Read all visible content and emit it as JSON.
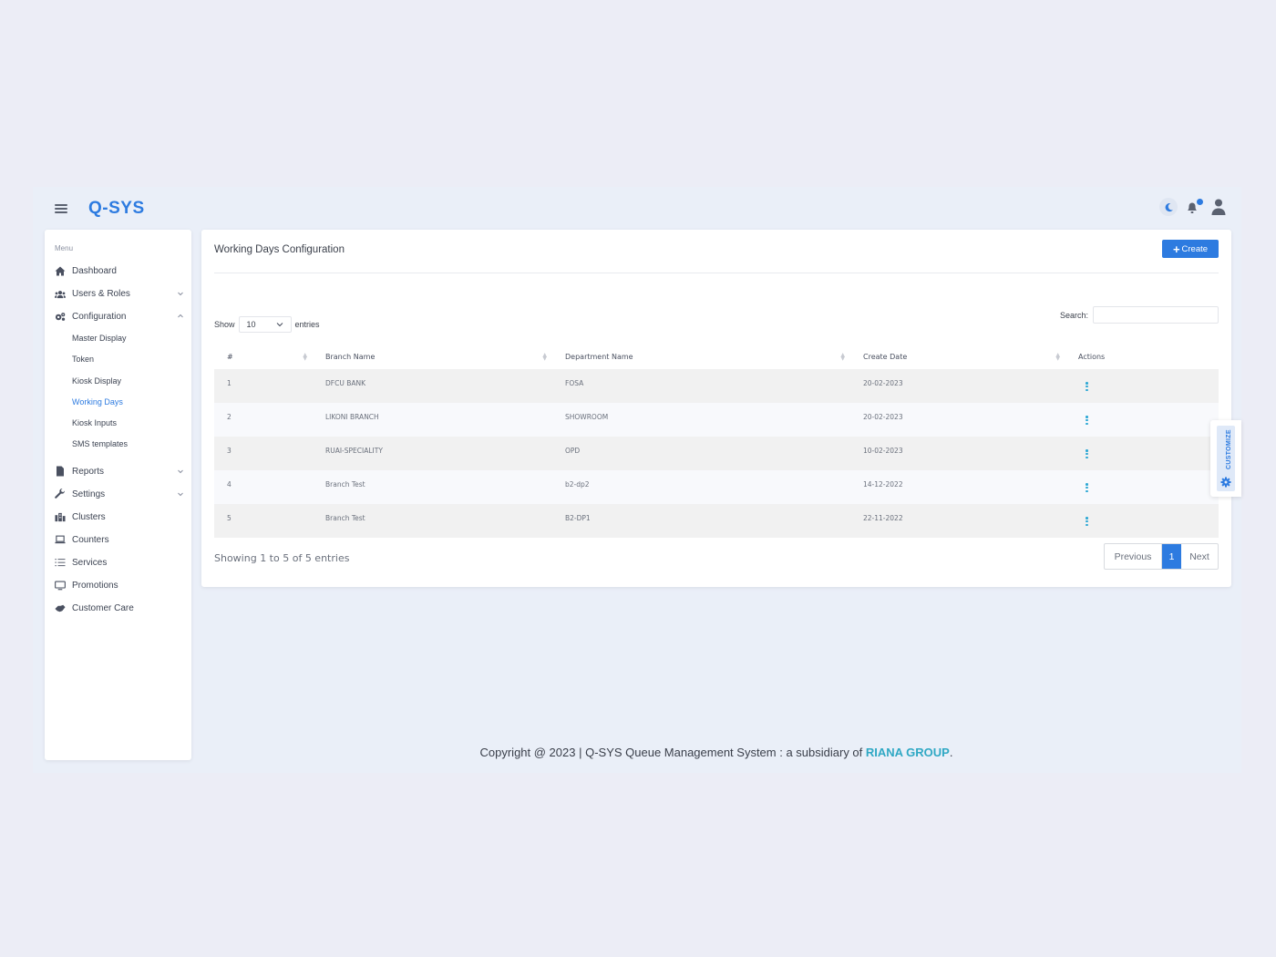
{
  "app": {
    "brand": "Q-SYS",
    "accent_color": "#2d7be0"
  },
  "topbar": {
    "icons": [
      "menu-icon",
      "moon-icon",
      "bell-icon",
      "user-icon"
    ]
  },
  "sidebar": {
    "menu_label": "Menu",
    "items": [
      {
        "label": "Dashboard",
        "icon": "home-icon"
      },
      {
        "label": "Users & Roles",
        "icon": "users-icon",
        "chevron": "down"
      },
      {
        "label": "Configuration",
        "icon": "cogs-icon",
        "chevron": "up",
        "children": [
          {
            "label": "Master Display"
          },
          {
            "label": "Token"
          },
          {
            "label": "Kiosk Display"
          },
          {
            "label": "Working Days",
            "active": true
          },
          {
            "label": "Kiosk Inputs"
          },
          {
            "label": "SMS templates"
          }
        ]
      },
      {
        "label": "Reports",
        "icon": "file-icon",
        "chevron": "down"
      },
      {
        "label": "Settings",
        "icon": "wrench-icon",
        "chevron": "down"
      },
      {
        "label": "Clusters",
        "icon": "building-icon"
      },
      {
        "label": "Counters",
        "icon": "laptop-icon"
      },
      {
        "label": "Services",
        "icon": "list-icon"
      },
      {
        "label": "Promotions",
        "icon": "desktop-icon"
      },
      {
        "label": "Customer Care",
        "icon": "handshake-icon"
      }
    ]
  },
  "main": {
    "title": "Working Days Configuration",
    "create_label": "Create",
    "show_label": "Show",
    "entries_label": "entries",
    "page_length": "10",
    "search_label": "Search:",
    "search_value": "",
    "columns": [
      "#",
      "Branch Name",
      "Department Name",
      "Create Date",
      "Actions"
    ],
    "rows": [
      {
        "num": "1",
        "branch": "DFCU BANK",
        "department": "FOSA",
        "date": "20-02-2023"
      },
      {
        "num": "2",
        "branch": "LIKONI BRANCH",
        "department": "SHOWROOM",
        "date": "20-02-2023"
      },
      {
        "num": "3",
        "branch": "RUAI-SPECIALITY",
        "department": "OPD",
        "date": "10-02-2023"
      },
      {
        "num": "4",
        "branch": "Branch Test",
        "department": "b2-dp2",
        "date": "14-12-2022"
      },
      {
        "num": "5",
        "branch": "Branch Test",
        "department": "B2-DP1",
        "date": "22-11-2022"
      }
    ],
    "info": "Showing 1 to 5 of 5 entries",
    "pagination": {
      "previous": "Previous",
      "current": "1",
      "next": "Next"
    }
  },
  "customize": {
    "label": "CUSTOMIZE"
  },
  "footer": {
    "text": "Copyright @ 2023 | Q-SYS Queue Management System : a subsidiary of ",
    "link": "RIANA GROUP",
    "suffix": "."
  }
}
